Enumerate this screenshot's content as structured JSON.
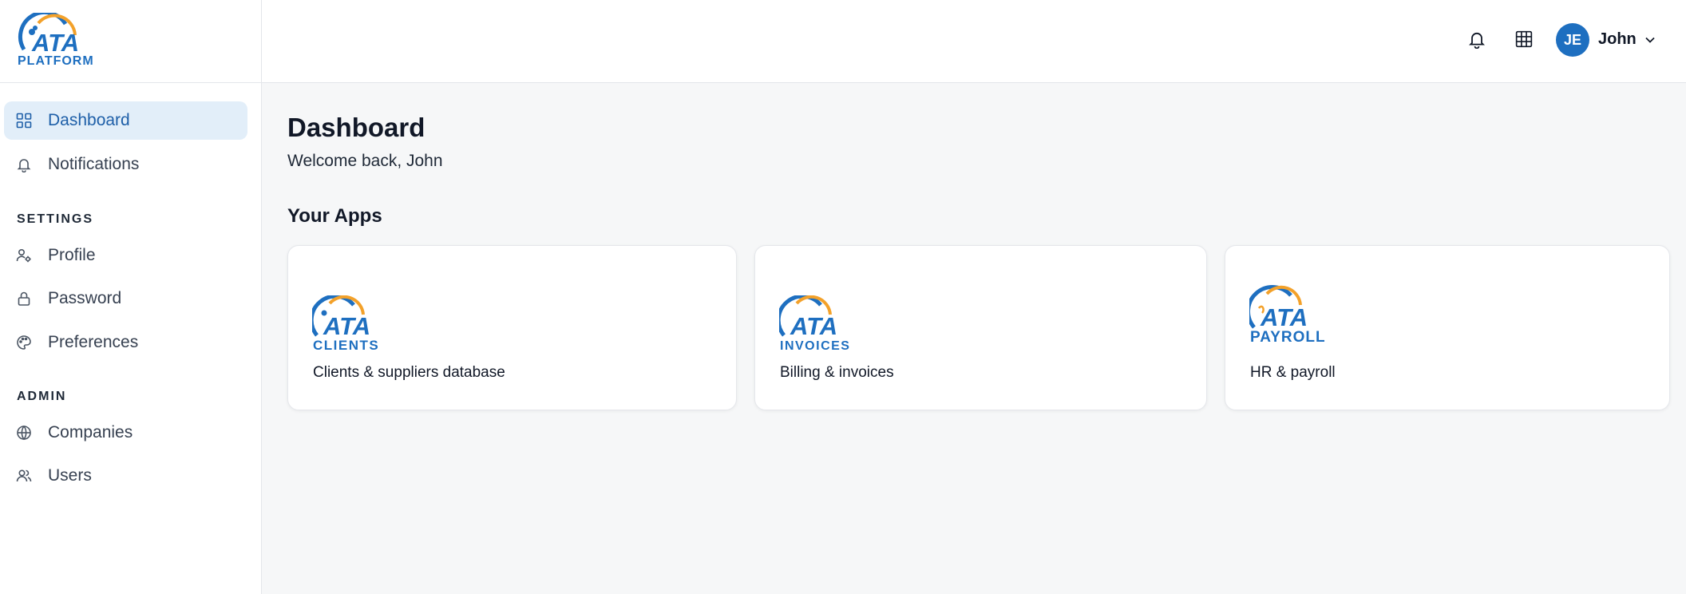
{
  "brand": {
    "logo_text": "ATA",
    "logo_sub": "PLATFORM"
  },
  "sidebar": {
    "items": [
      {
        "label": "Dashboard",
        "icon": "grid-icon",
        "active": true
      },
      {
        "label": "Notifications",
        "icon": "bell-icon"
      }
    ],
    "settings_title": "SETTINGS",
    "settings_items": [
      {
        "label": "Profile",
        "icon": "user-gear-icon"
      },
      {
        "label": "Password",
        "icon": "lock-icon"
      },
      {
        "label": "Preferences",
        "icon": "palette-icon"
      }
    ],
    "admin_title": "ADMIN",
    "admin_items": [
      {
        "label": "Companies",
        "icon": "globe-icon"
      },
      {
        "label": "Users",
        "icon": "users-icon"
      }
    ]
  },
  "header": {
    "avatar_initials": "JE",
    "user_name": "John"
  },
  "main": {
    "title": "Dashboard",
    "subtitle": "Welcome back, John",
    "apps_title": "Your Apps",
    "apps": [
      {
        "logo_text": "ATA",
        "logo_sub": "CLIENTS",
        "description": "Clients & suppliers database"
      },
      {
        "logo_text": "ATA",
        "logo_sub": "INVOICES",
        "description": "Billing & invoices"
      },
      {
        "logo_text": "ATA",
        "logo_sub": "PAYROLL",
        "description": "HR & payroll"
      }
    ]
  },
  "colors": {
    "brand_blue": "#1e6fc0",
    "brand_orange": "#f3a12a",
    "active_bg": "#e2eef9"
  }
}
